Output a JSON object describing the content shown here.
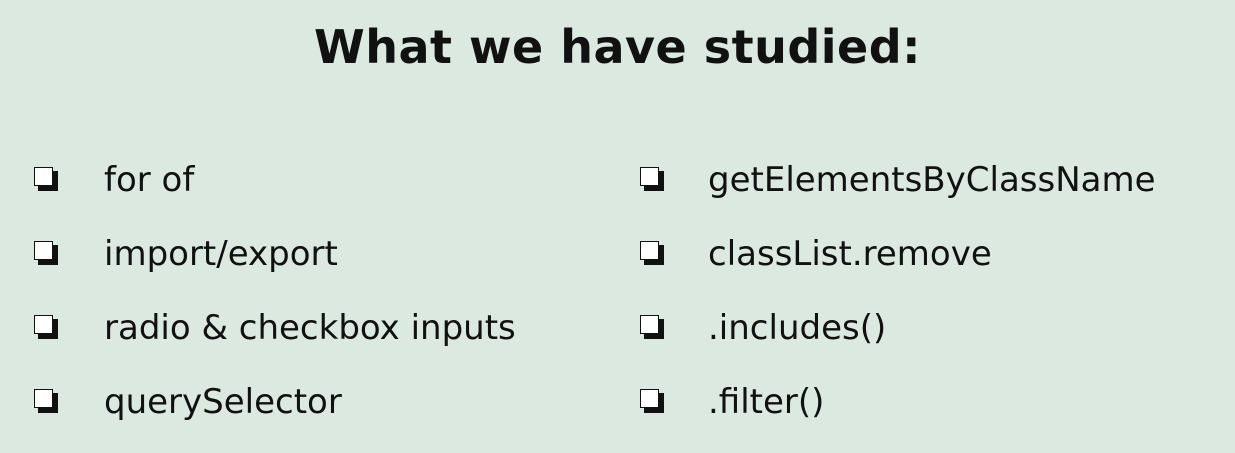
{
  "title": "What we have studied:",
  "left_items": [
    "for of",
    "import/export",
    "radio & checkbox inputs",
    "querySelector"
  ],
  "right_items": [
    "getElementsByClassName",
    "classList.remove",
    ".includes()",
    ".filter()"
  ],
  "colors": {
    "background": "#dce9e0",
    "text": "#111111"
  },
  "bullet_icon": "shadowed-checkbox-icon"
}
